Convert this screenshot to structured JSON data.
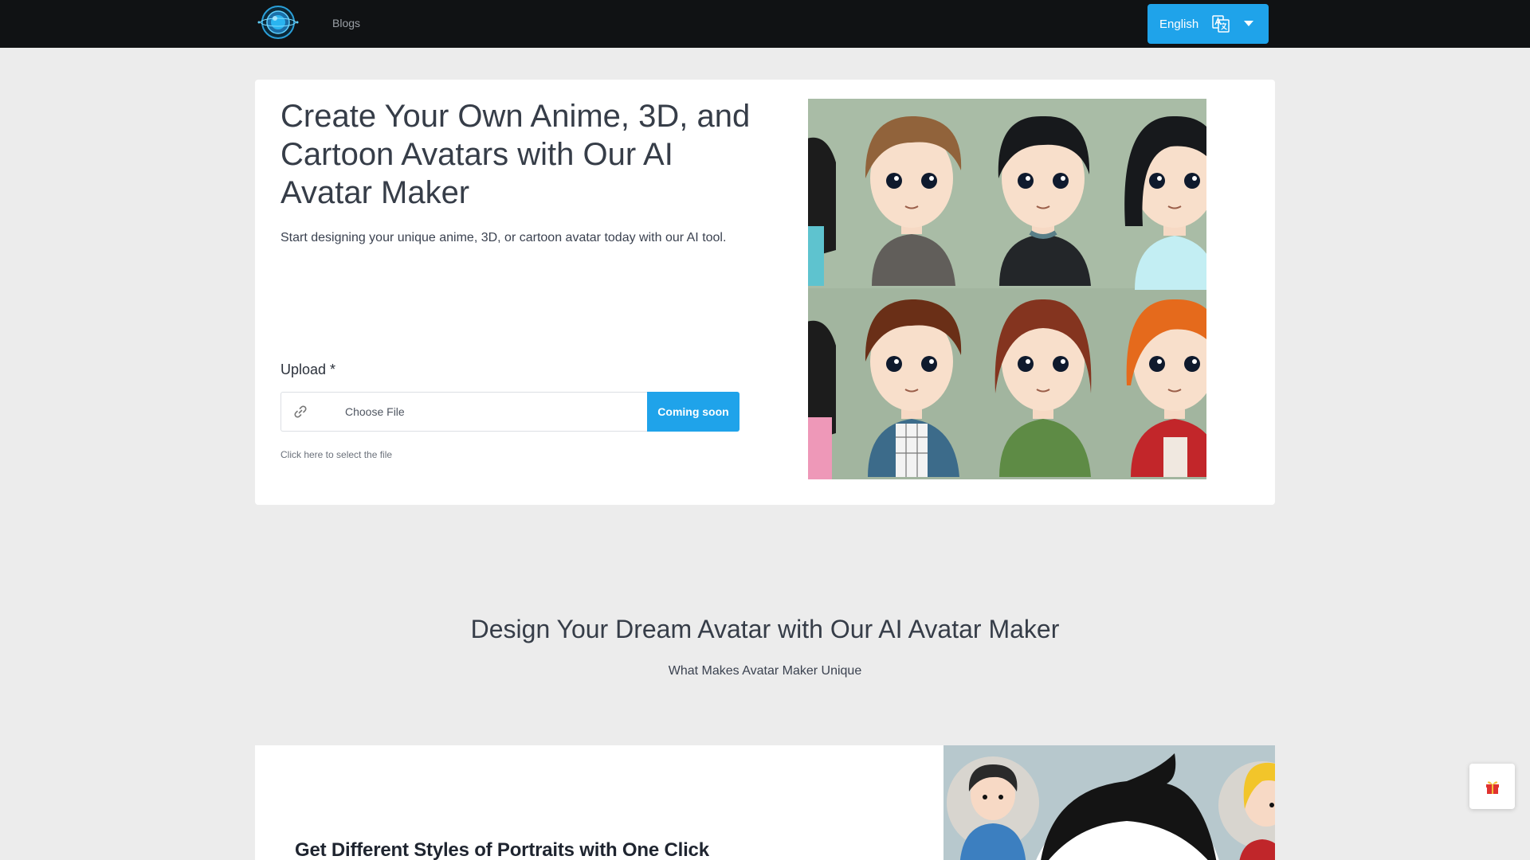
{
  "nav": {
    "blogs_label": "Blogs",
    "language_label": "English"
  },
  "hero": {
    "title": "Create Your Own Anime, 3D, and Cartoon Avatars with Our AI Avatar Maker",
    "subtitle": "Start designing your unique anime, 3D, or cartoon avatar today with our AI tool.",
    "upload_label": "Upload *",
    "file_placeholder": "Choose File",
    "button_label": "Coming soon",
    "help_text": "Click here to select the file"
  },
  "section": {
    "title": "Design Your Dream Avatar with Our AI Avatar Maker",
    "subtitle": "What Makes Avatar Maker Unique"
  },
  "feature": {
    "title": "Get Different Styles of Portraits with One Click"
  },
  "colors": {
    "accent": "#1fa3ea",
    "topbar": "#101214",
    "page_bg": "#ececec",
    "card_bg": "#ffffff"
  },
  "icons": {
    "logo": "globe-logo-icon",
    "language": "translate-icon",
    "dropdown": "caret-down-icon",
    "file": "link-icon",
    "float": "gift-icon"
  }
}
